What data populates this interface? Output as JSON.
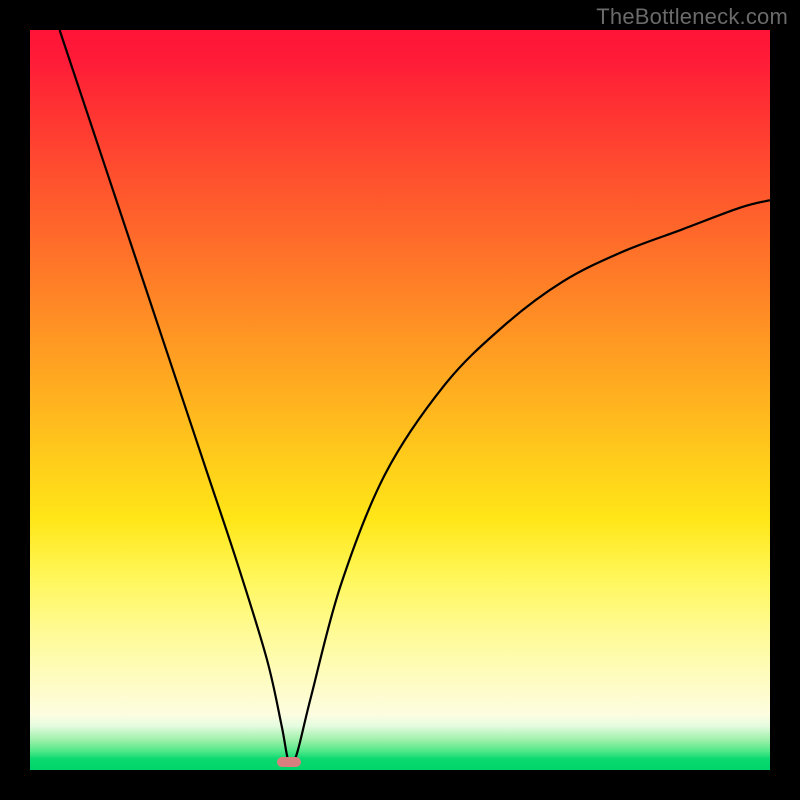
{
  "watermark": "TheBottleneck.com",
  "chart_data": {
    "type": "line",
    "title": "",
    "xlabel": "",
    "ylabel": "",
    "xlim": [
      0,
      100
    ],
    "ylim": [
      0,
      100
    ],
    "grid": false,
    "legend": false,
    "background": "gradient-red-to-green",
    "series": [
      {
        "name": "bottleneck-curve",
        "x": [
          4,
          8,
          12,
          16,
          20,
          24,
          28,
          32,
          34,
          35,
          36,
          38,
          42,
          48,
          56,
          64,
          72,
          80,
          88,
          96,
          100
        ],
        "y": [
          100,
          88,
          76,
          64,
          52,
          40,
          28,
          15,
          6,
          1,
          2,
          10,
          25,
          40,
          52,
          60,
          66,
          70,
          73,
          76,
          77
        ]
      }
    ],
    "annotations": [
      {
        "type": "marker",
        "shape": "rounded-rect",
        "x": 35,
        "y": 0.5,
        "color": "#d88080"
      }
    ]
  }
}
